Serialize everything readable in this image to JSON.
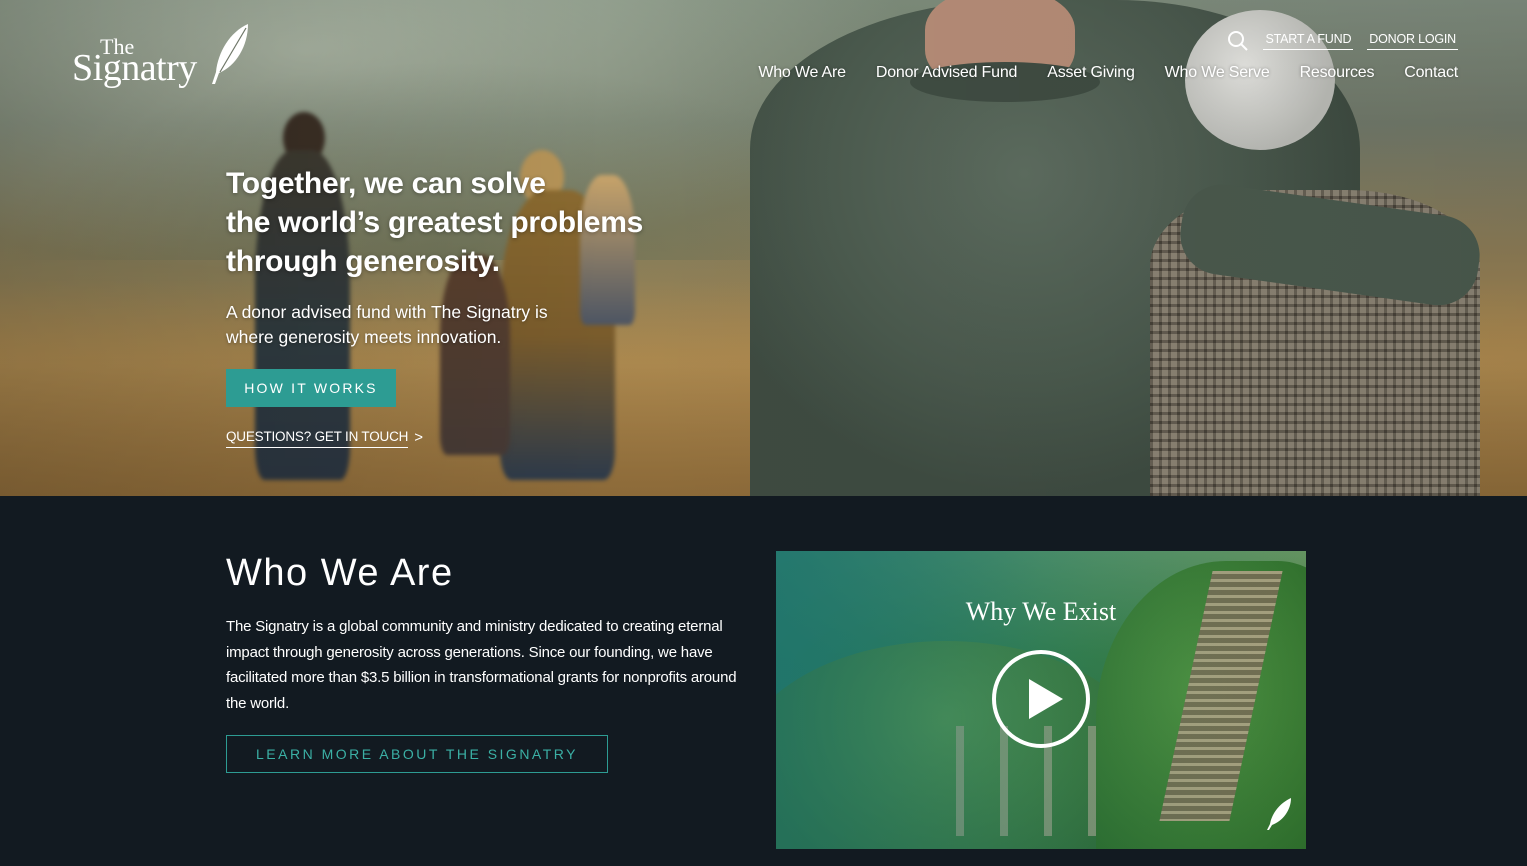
{
  "brand": {
    "the": "The",
    "name": "Signatry"
  },
  "utility": {
    "start_fund": "START A FUND",
    "donor_login": "DONOR LOGIN"
  },
  "nav": {
    "items": [
      "Who We Are",
      "Donor Advised Fund",
      "Asset Giving",
      "Who We Serve",
      "Resources",
      "Contact"
    ]
  },
  "hero": {
    "title_lines": [
      "Together, we can solve",
      "the world’s greatest problems",
      "through generosity."
    ],
    "subtitle_lines": [
      "A donor advised fund with The Signatry is",
      "where generosity meets innovation."
    ],
    "cta": "HOW IT WORKS",
    "contact_link": "QUESTIONS? GET IN TOUCH",
    "contact_chevron": ">"
  },
  "who": {
    "heading": "Who We Are",
    "body": "The Signatry is a global community and ministry dedicated to creating eternal impact through generosity across generations. Since our founding, we have facilitated more than $3.5 billion in transformational grants for nonprofits around the world.",
    "cta": "LEARN MORE ABOUT THE SIGNATRY"
  },
  "video": {
    "title": "Why We Exist"
  },
  "colors": {
    "teal": "#2d9c93",
    "dark_bg": "#121a21",
    "white": "#ffffff"
  },
  "icons": {
    "search": "search-icon",
    "play": "play-icon",
    "feather": "feather-icon"
  }
}
